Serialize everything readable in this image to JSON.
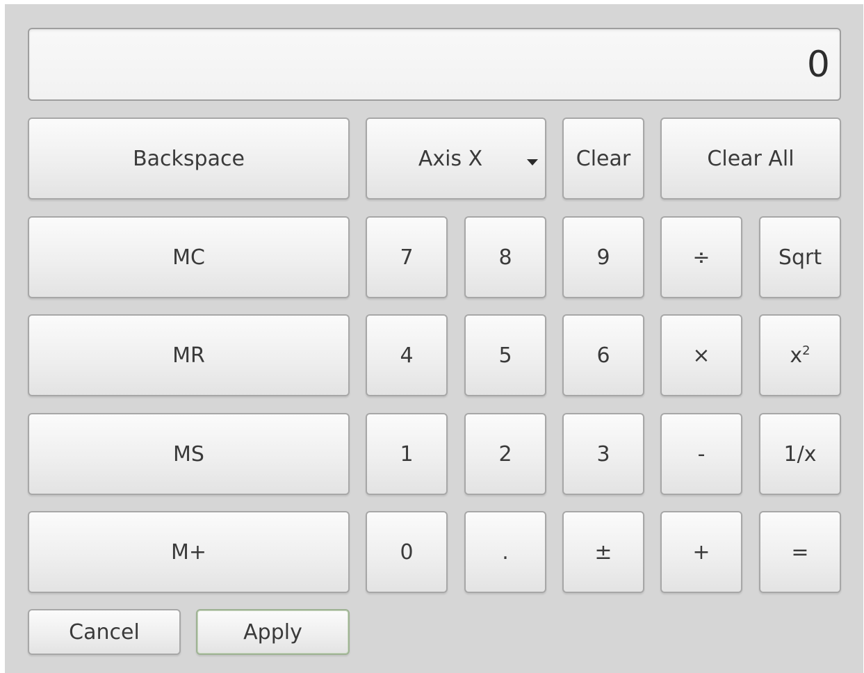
{
  "display": {
    "value": "0"
  },
  "top_row": {
    "backspace": "Backspace",
    "axis_dropdown": {
      "selected": "Axis X"
    },
    "clear": "Clear",
    "clear_all": "Clear All"
  },
  "memory": {
    "mc": "MC",
    "mr": "MR",
    "ms": "MS",
    "mplus": "M+"
  },
  "keypad": {
    "seven": "7",
    "eight": "8",
    "nine": "9",
    "divide": "÷",
    "sqrt": "Sqrt",
    "four": "4",
    "five": "5",
    "six": "6",
    "multiply": "×",
    "square_base": "x",
    "square_exp": "2",
    "one": "1",
    "two": "2",
    "three": "3",
    "minus": "-",
    "reciprocal": "1/x",
    "zero": "0",
    "decimal": ".",
    "plus_minus": "±",
    "plus": "+",
    "equals": "="
  },
  "footer": {
    "cancel": "Cancel",
    "apply": "Apply"
  },
  "colors": {
    "panel_background": "#d6d6d6",
    "button_border": "#a7a7a7",
    "apply_border": "#9fb394"
  },
  "icons": {
    "dropdown": "chevron-down-icon"
  }
}
